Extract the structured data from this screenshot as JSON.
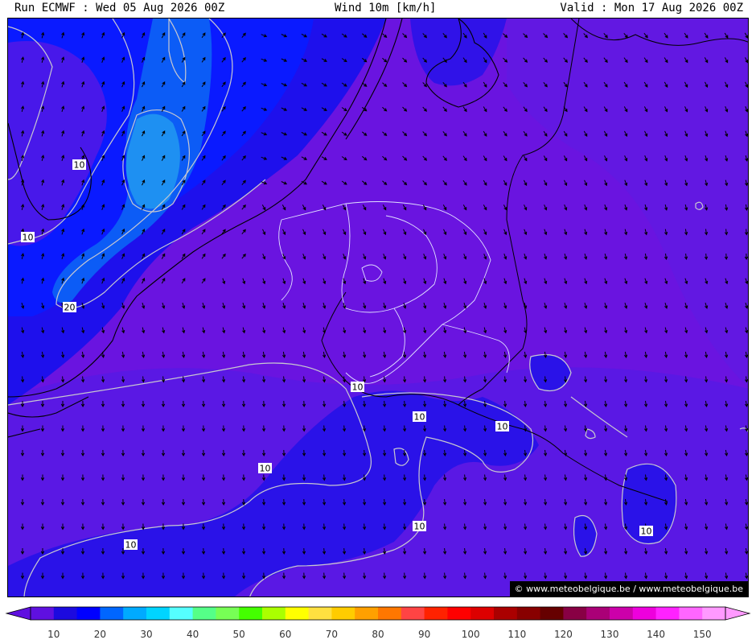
{
  "header": {
    "left": "Run ECMWF : Wed 05 Aug 2026 00Z",
    "center": "Wind 10m [km/h]",
    "right": "Valid : Mon 17 Aug 2026 00Z"
  },
  "watermark": "© www.meteobelgique.be / www.meteobelgique.be",
  "colors": {
    "violet_low": "#6a14e0",
    "violet_mid": "#5a1ee6",
    "blue_deep": "#2a12e8",
    "blue_med": "#0a1aff",
    "blue_sea": "#0838f0",
    "cyan_light": "#1e8cf2",
    "contour": "#c8c8d0",
    "border_white": "#e0e0ff"
  },
  "contour_labels": [
    "10",
    "10",
    "20",
    "10",
    "10",
    "10",
    "10",
    "10",
    "10",
    "10"
  ],
  "legend": {
    "ticks": [
      "10",
      "20",
      "30",
      "40",
      "50",
      "60",
      "70",
      "80",
      "90",
      "100",
      "110",
      "120",
      "130",
      "140",
      "150"
    ],
    "colors": [
      "#5f10e0",
      "#1c0adf",
      "#0000ff",
      "#0066ff",
      "#00aaff",
      "#00d4ff",
      "#55ffff",
      "#55ff88",
      "#77ff55",
      "#44ff00",
      "#aaff00",
      "#ffff00",
      "#ffe040",
      "#ffcc00",
      "#ffa000",
      "#ff7700",
      "#ff4444",
      "#ff2200",
      "#ff0000",
      "#dd0000",
      "#aa0000",
      "#880000",
      "#660000",
      "#880044",
      "#aa0077",
      "#cc00aa",
      "#ee00dd",
      "#ff22ff",
      "#ff66ff",
      "#ff99ff"
    ]
  }
}
